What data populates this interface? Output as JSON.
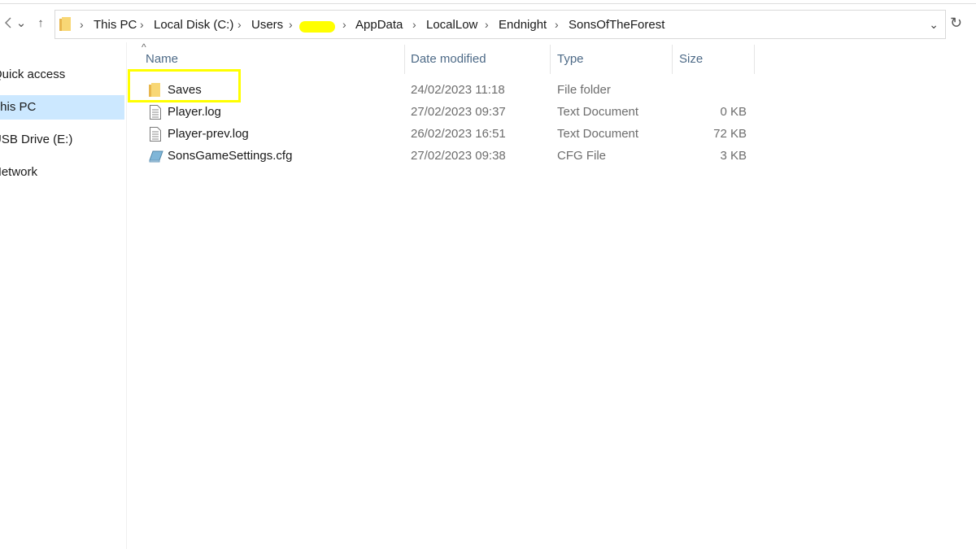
{
  "breadcrumb": {
    "items": [
      "This PC",
      "Local Disk (C:)",
      "Users",
      "",
      "AppData",
      "LocalLow",
      "Endnight",
      "SonsOfTheForest"
    ],
    "separator": "›"
  },
  "nav": {
    "back_icon": "chevron-left-icon",
    "recent_icon": "chevron-down-icon",
    "up_icon": "up-arrow-icon",
    "up_glyph": "↑",
    "recent_glyph": "⌄",
    "dropdown_glyph": "⌄",
    "refresh_glyph": "↻"
  },
  "sidebar": {
    "items": [
      {
        "label": "Quick access",
        "selected": false
      },
      {
        "label": "This PC",
        "selected": true
      },
      {
        "label": "USB Drive (E:)",
        "selected": false
      },
      {
        "label": "Network",
        "selected": false
      }
    ]
  },
  "columns": {
    "name": "Name",
    "date": "Date modified",
    "type": "Type",
    "size": "Size",
    "sort_glyph": "^"
  },
  "files": [
    {
      "name": "Saves",
      "date": "24/02/2023 11:18",
      "type": "File folder",
      "size": "",
      "icon": "folder-icon"
    },
    {
      "name": "Player.log",
      "date": "27/02/2023 09:37",
      "type": "Text Document",
      "size": "0 KB",
      "icon": "text-file-icon"
    },
    {
      "name": "Player-prev.log",
      "date": "26/02/2023 16:51",
      "type": "Text Document",
      "size": "72 KB",
      "icon": "text-file-icon"
    },
    {
      "name": "SonsGameSettings.cfg",
      "date": "27/02/2023 09:38",
      "type": "CFG File",
      "size": "3 KB",
      "icon": "config-file-icon"
    }
  ],
  "colors": {
    "selected_bg": "#cce8ff",
    "highlight": "#ffff00",
    "header_text": "#4d6a87"
  }
}
